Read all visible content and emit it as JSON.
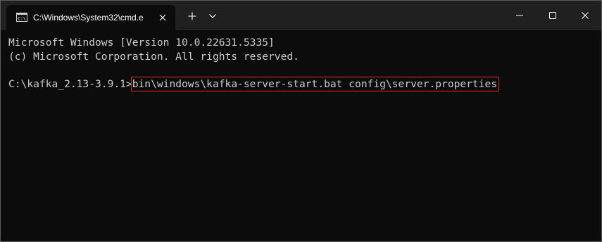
{
  "window": {
    "tab_title": "C:\\Windows\\System32\\cmd.e",
    "icons": {
      "tab": "cmd-icon",
      "tab_close": "close-icon",
      "new_tab": "plus-icon",
      "dropdown": "chevron-down-icon",
      "minimize": "minimize-icon",
      "maximize": "maximize-icon",
      "close": "close-icon"
    }
  },
  "console": {
    "line1": "Microsoft Windows [Version 10.0.22631.5335]",
    "line2": "(c) Microsoft Corporation. All rights reserved.",
    "prompt": "C:\\kafka_2.13-3.9.1>",
    "command": "bin\\windows\\kafka-server-start.bat config\\server.properties"
  },
  "colors": {
    "terminal_bg": "#0c0c0c",
    "titlebar_bg": "#202020",
    "text": "#cccccc",
    "highlight_border": "#e02525"
  }
}
